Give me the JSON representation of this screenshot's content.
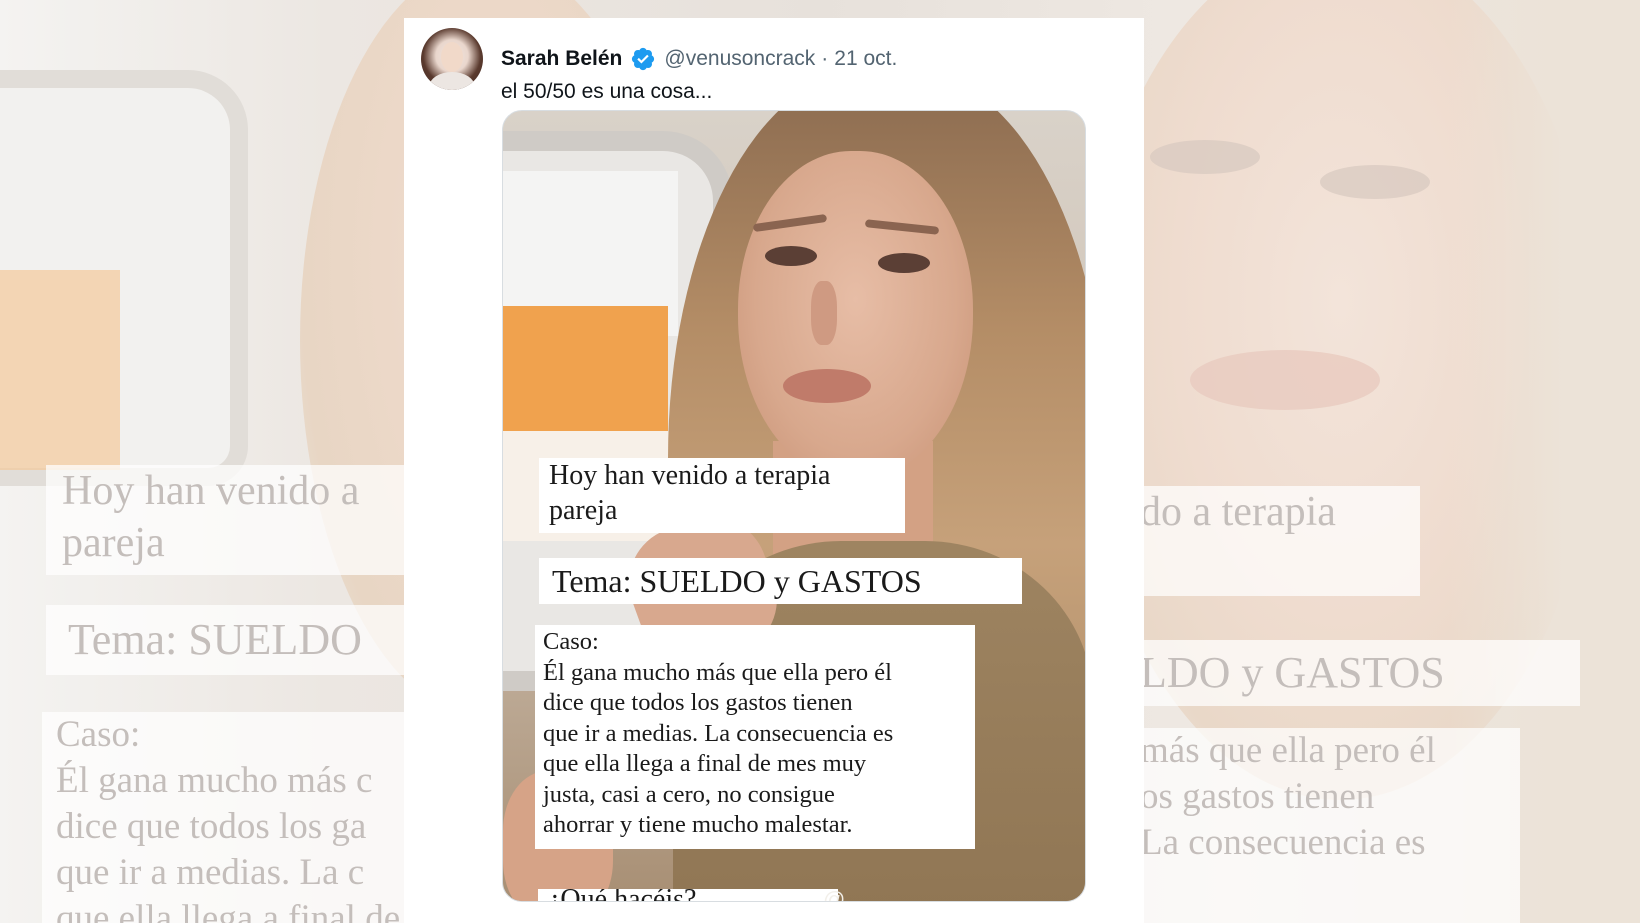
{
  "tweet": {
    "author_name": "Sarah Belén",
    "handle": "@venusoncrack",
    "separator": "·",
    "date": "21 oct.",
    "text": "el 50/50 es una cosa..."
  },
  "media": {
    "caption_intro": [
      "Hoy han venido a terapia",
      "pareja"
    ],
    "caption_topic": "Tema: SUELDO y GASTOS",
    "caption_case": [
      "Caso:",
      "Él gana mucho más que ella pero él",
      "dice que todos los gastos tienen",
      "que ir a medias. La consecuencia es",
      "que ella llega a final de mes muy",
      "justa, casi a cero, no consigue",
      "ahorrar y tiene mucho malestar."
    ],
    "caption_cut": "¿Qué hacéis?",
    "watermark": "@..."
  },
  "background": {
    "left_intro": [
      "Hoy han venido a",
      "pareja"
    ],
    "left_topic": "Tema: SUELDO",
    "left_case": [
      "Caso:",
      "Él gana mucho más c",
      "dice que todos los ga",
      "que ir a medias. La c",
      "que ella llega a final de mes muy"
    ],
    "right_intro": [
      "do a terapia",
      ""
    ],
    "right_topic": "LDO y GASTOS",
    "right_case": [
      "más que ella pero él",
      "os gastos tienen",
      "La consecuencia es",
      ""
    ]
  },
  "colors": {
    "verified": "#1d9bf0",
    "text_primary": "#0f1419",
    "text_secondary": "#536471"
  },
  "icons": [
    "verified-badge-icon"
  ]
}
